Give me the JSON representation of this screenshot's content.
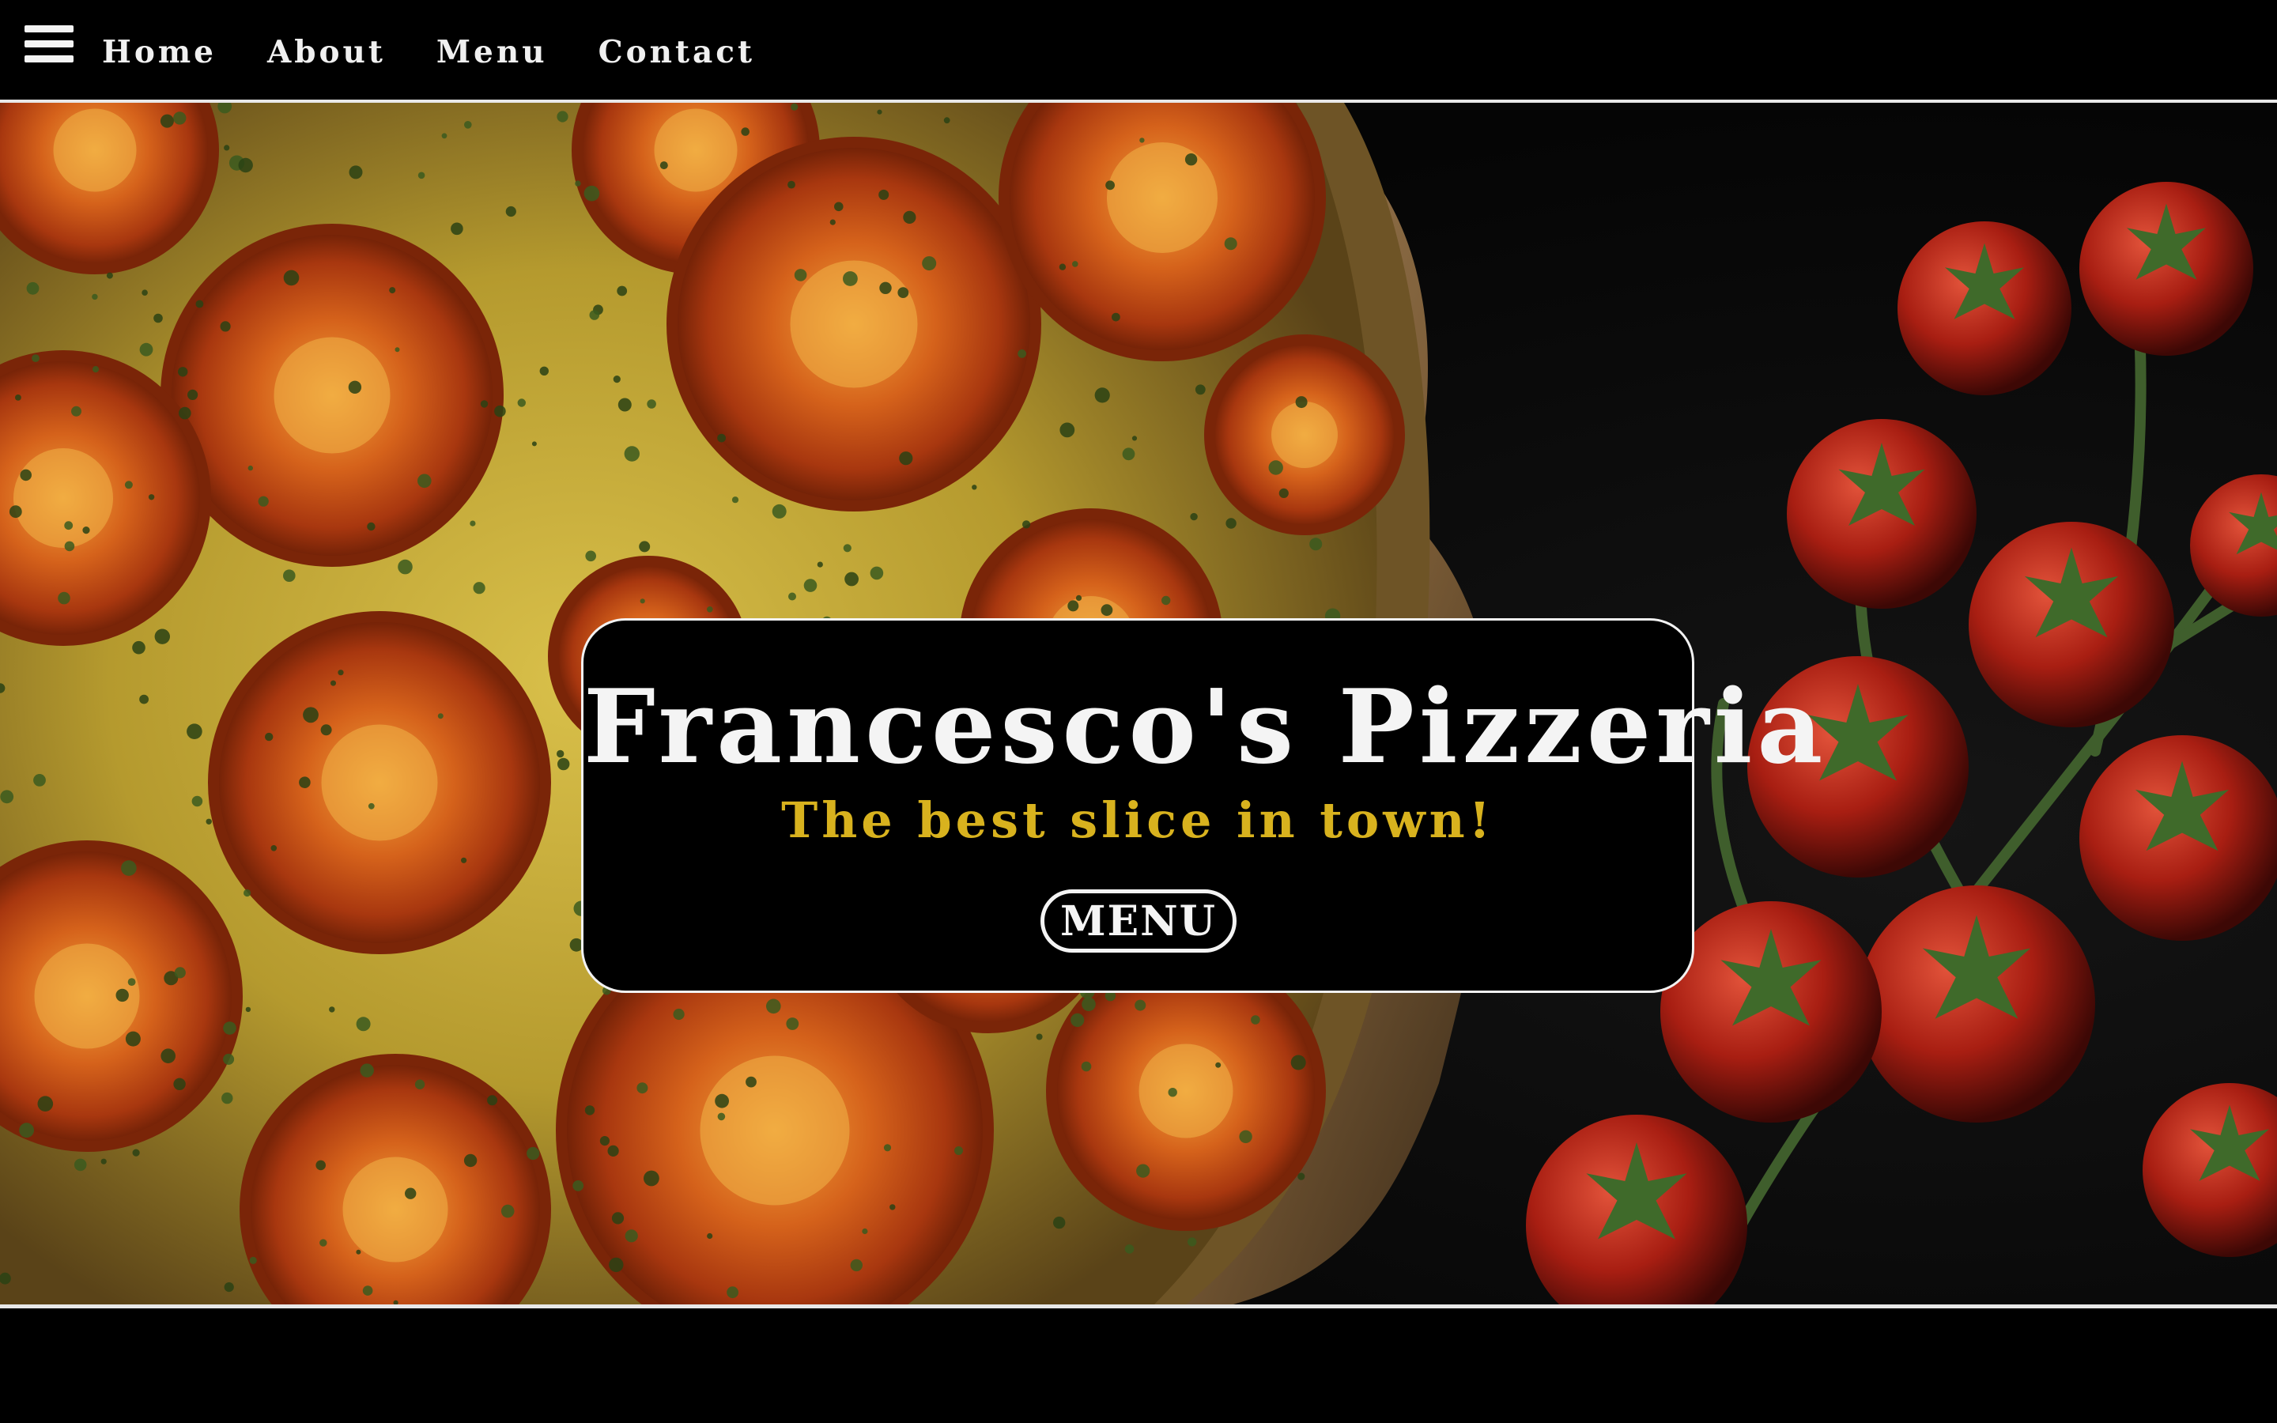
{
  "nav": {
    "menu_icon": "hamburger-menu-icon",
    "links": [
      "Home",
      "About",
      "Menu",
      "Contact"
    ]
  },
  "hero": {
    "image": "pizza-with-tomatoes-photo",
    "title": "Francesco's Pizzeria",
    "subtitle": "The best slice in town!",
    "cta_label": "MENU"
  },
  "colors": {
    "background": "#000000",
    "text": "#f4f4f4",
    "accent": "#d8b21e",
    "tomato": "#c2410c",
    "cheese": "#e7d24a"
  }
}
